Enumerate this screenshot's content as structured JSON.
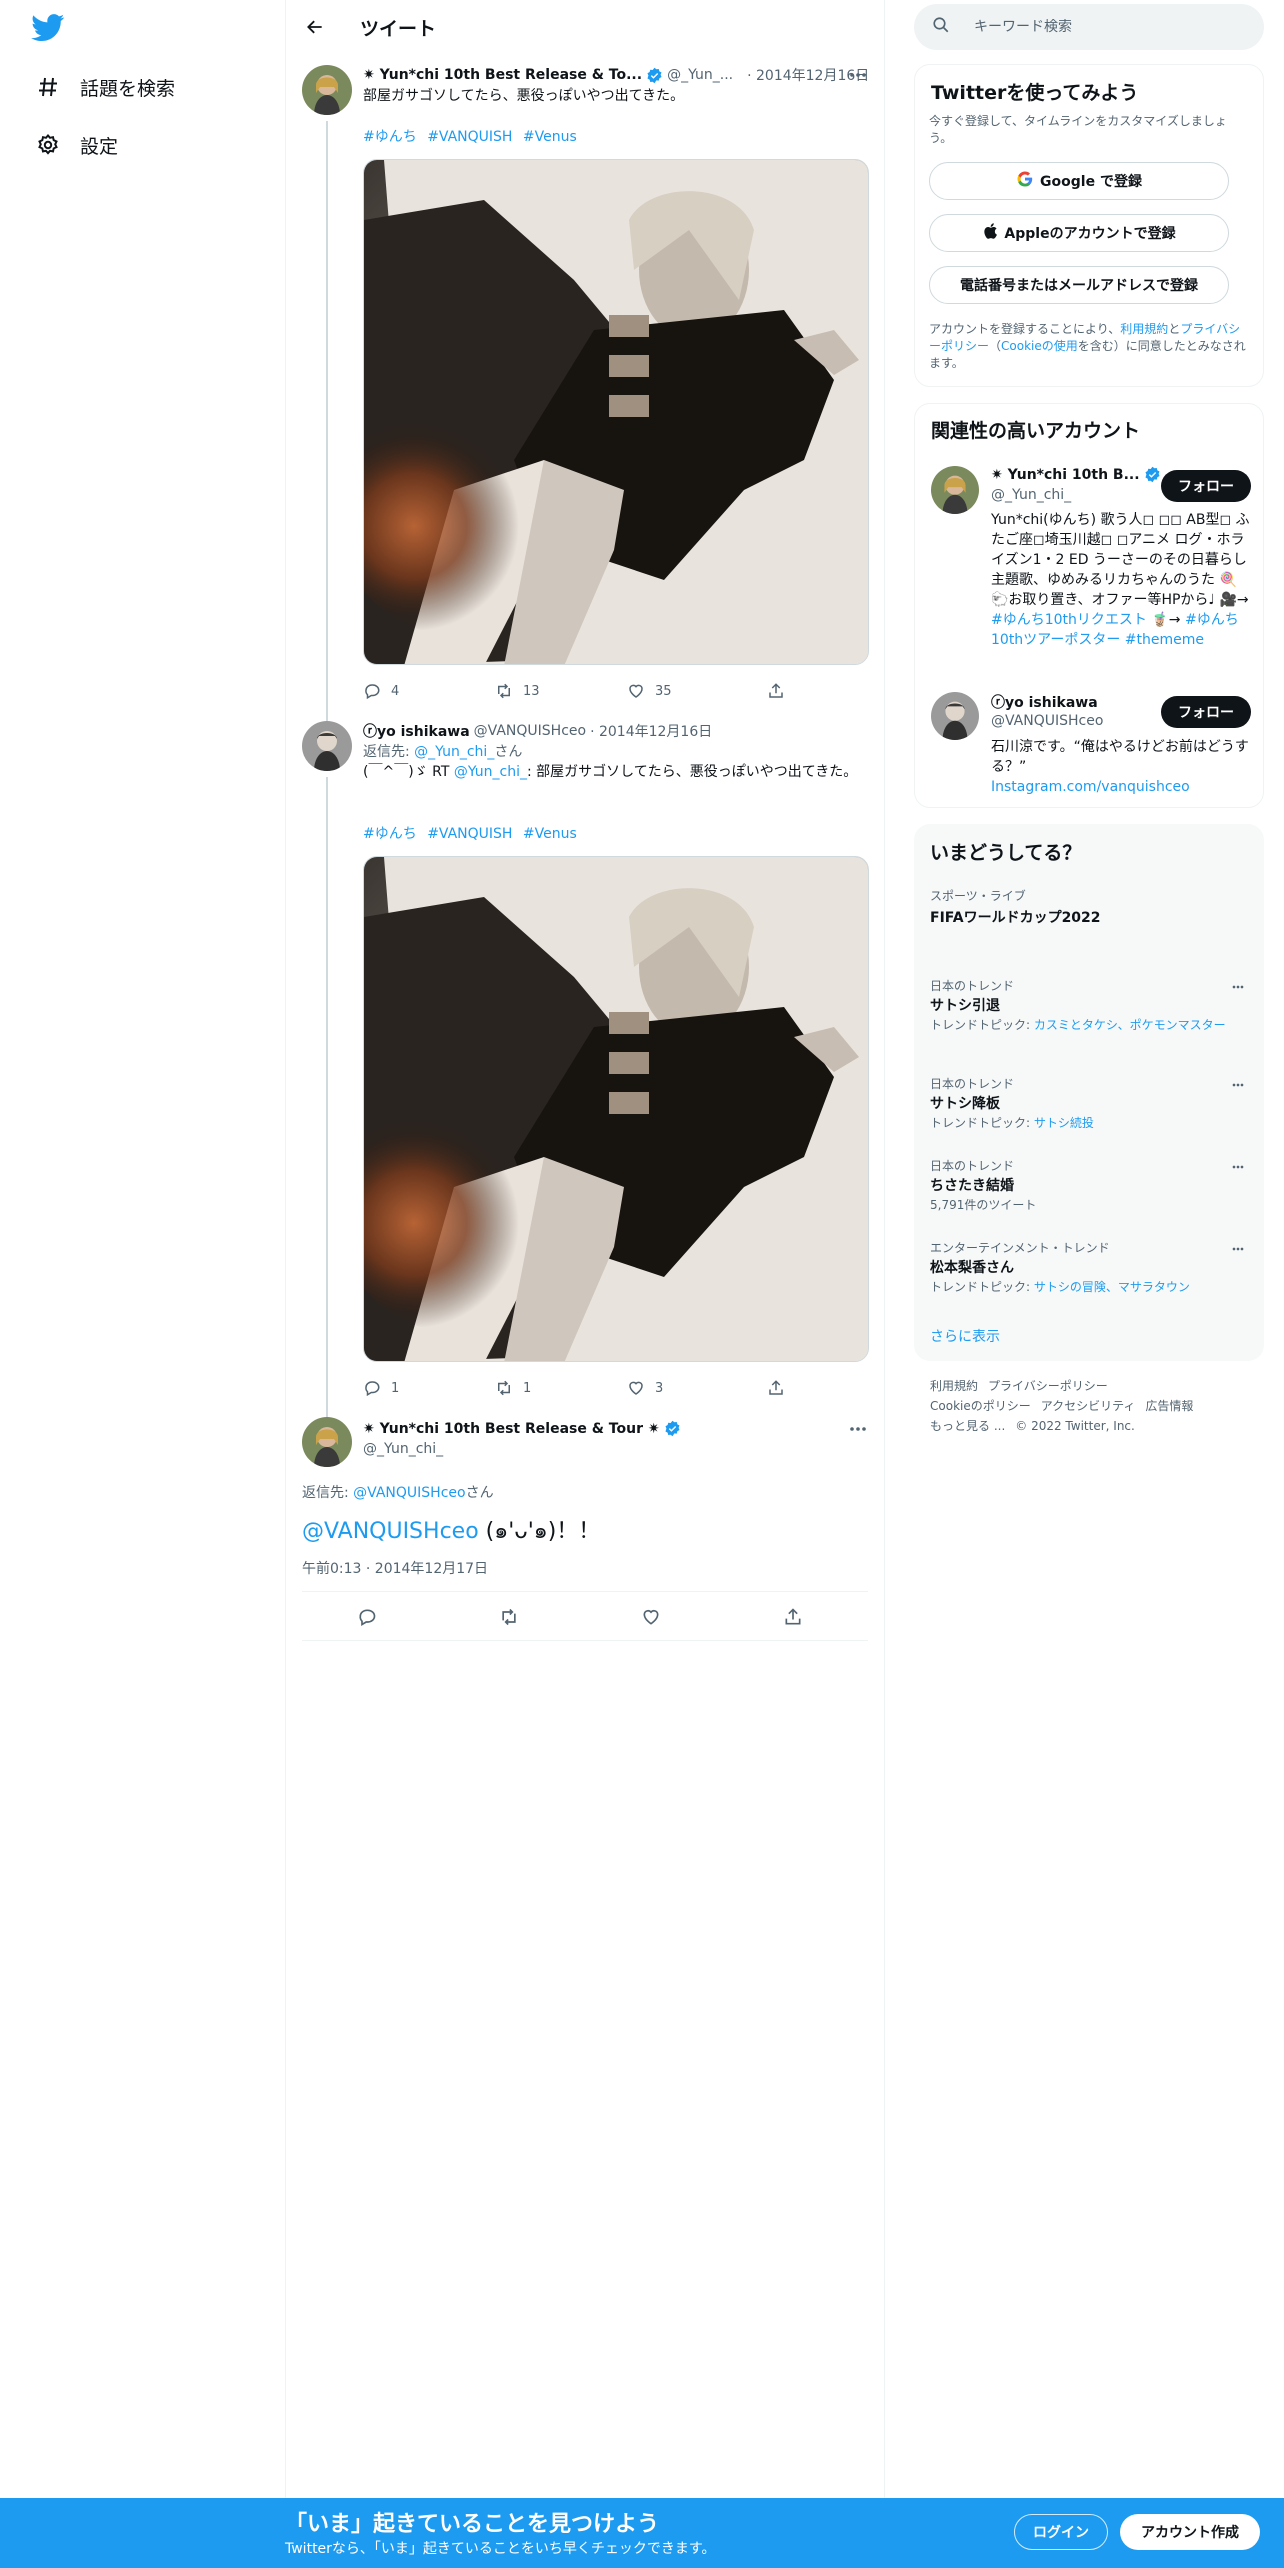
{
  "nav": {
    "items": [
      {
        "label": "話題を検索",
        "icon": "hashtag-icon"
      },
      {
        "label": "設定",
        "icon": "gear-icon"
      }
    ]
  },
  "header": {
    "title": "ツイート"
  },
  "tweets": [
    {
      "name": "✷ Yun*chi 10th Best Release & To...",
      "handle": "@_Yun_...",
      "date": "· 2014年12月16日",
      "text": "部屋ガサゴソしてたら、悪役っぽいやつ出てきた。",
      "hashtags": [
        "#ゆんち",
        "#VANQUISH",
        "#Venus"
      ],
      "replies": "4",
      "retweets": "13",
      "likes": "35"
    },
    {
      "name": "ⓡyo ishikawa",
      "handle": "@VANQUISHceo",
      "date": "· 2014年12月16日",
      "reply_prefix": "返信先: ",
      "reply_to": "@_Yun_chi_",
      "reply_suffix": "さん",
      "text_pre": "(￣^￣)ゞ RT ",
      "text_mention": "@Yun_chi_",
      "text_post": ": 部屋ガサゴソしてたら、悪役っぽいやつ出てきた。",
      "hashtags": [
        "#ゆんち",
        "#VANQUISH",
        "#Venus"
      ],
      "replies": "1",
      "retweets": "1",
      "likes": "3"
    }
  ],
  "focus": {
    "name": "✷ Yun*chi 10th Best Release & Tour ✷",
    "handle": "@_Yun_chi_",
    "reply_prefix": "返信先: ",
    "reply_to": "@VANQUISHceo",
    "reply_suffix": "さん",
    "mention": "@VANQUISHceo",
    "text": " (๑'ᴗ'๑)！！",
    "datetime": "午前0:13 · 2014年12月17日"
  },
  "search": {
    "placeholder": "キーワード検索"
  },
  "signup_card": {
    "title": "Twitterを使ってみよう",
    "subtitle": "今すぐ登録して、タイムラインをカスタマイズしましょう。",
    "google": "Google で登録",
    "apple": "Appleのアカウントで登録",
    "phone": "電話番号またはメールアドレスで登録",
    "terms_1": "アカウントを登録することにより、",
    "terms_link1": "利用規約",
    "terms_2": "と",
    "terms_link2": "プライバシーポリシー",
    "terms_3": "（",
    "terms_link3": "Cookieの使用",
    "terms_4": "を含む）に同意したとみなされます。"
  },
  "related": {
    "title": "関連性の高いアカウント",
    "follow_label": "フォロー",
    "accounts": [
      {
        "name": "✷ Yun*chi 10th B...",
        "handle": "@_Yun_chi_",
        "bio": "Yun*chi(ゆんち) 歌う人◻︎ ◻︎◻︎ AB型◻︎ ふたご座◻︎埼玉川越◻︎ ◻︎アニメ ログ・ホライズン1・2 ED うーさーのその日暮らし 主題歌、ゆめみるリカちゃんのうた 🍭🐑お取り置き、オファー等HPから♩ 🎥→ ",
        "bio_link1": "#ゆんち10thリクエスト",
        "bio_mid": " 🧋→ ",
        "bio_link2": "#ゆんち10thツアーポスター",
        "bio_link3": "#thememe"
      },
      {
        "name": "ⓡyo ishikawa",
        "handle": "@VANQUISHceo",
        "bio": "石川涼です。“俺はやるけどお前はどうする？”",
        "bio_link": "Instagram.com/vanquishceo"
      }
    ]
  },
  "trends": {
    "title": "いまどうしてる？",
    "items": [
      {
        "category": "スポーツ・ライブ",
        "name": "FIFAワールドカップ2022",
        "meta": ""
      },
      {
        "category": "日本のトレンド",
        "name": "サトシ引退",
        "meta_prefix": "トレンドトピック: ",
        "meta_links": "カスミとタケシ、ポケモンマスター"
      },
      {
        "category": "日本のトレンド",
        "name": "サトシ降板",
        "meta_prefix": "トレンドトピック: ",
        "meta_links": "サトシ続投"
      },
      {
        "category": "日本のトレンド",
        "name": "ちさたき結婚",
        "meta": "5,791件のツイート"
      },
      {
        "category": "エンターテインメント・トレンド",
        "name": "松本梨香さん",
        "meta_prefix": "トレンドトピック: ",
        "meta_links": "サトシの冒険、マサラタウン"
      }
    ],
    "show_more": "さらに表示"
  },
  "footer": {
    "links": [
      "利用規約",
      "プライバシーポリシー",
      "Cookieのポリシー",
      "アクセシビリティ",
      "広告情報",
      "もっと見る ...",
      "© 2022 Twitter, Inc."
    ]
  },
  "banner": {
    "title": "「いま」起きていることを見つけよう",
    "subtitle": "Twitterなら、「いま」起きていることをいち早くチェックできます。",
    "login": "ログイン",
    "signup": "アカウント作成"
  },
  "colors": {
    "accent": "#1d9bf0",
    "text": "#0f1419",
    "muted": "#536471"
  }
}
